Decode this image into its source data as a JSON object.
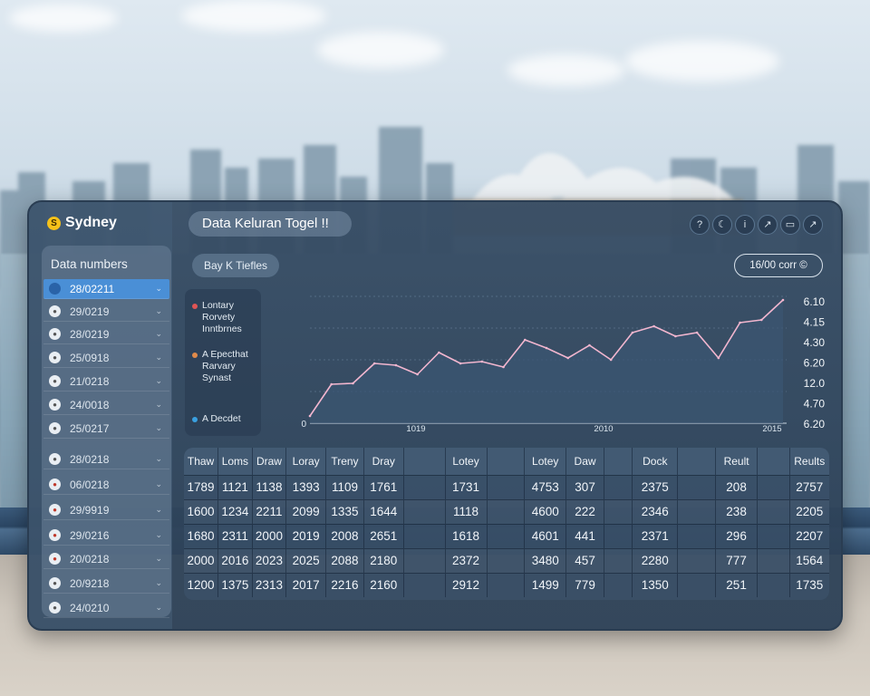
{
  "brand": {
    "name": "Sydney",
    "badge": "S"
  },
  "header": {
    "title": "Data Keluran Togel !!",
    "subtitle": "Bay K Tiefles"
  },
  "toolbar": [
    "?",
    "☾",
    "i",
    "↗",
    "▭",
    "↗"
  ],
  "counter": "16/00 corr ©",
  "sidebar": {
    "title": "Data numbers",
    "items": [
      {
        "label": "28/02211",
        "active": true
      },
      {
        "label": "29/0219",
        "active": false
      },
      {
        "label": "28/0219",
        "active": false
      },
      {
        "label": "25/0918",
        "active": false
      },
      {
        "label": "21/0218",
        "active": false
      },
      {
        "label": "24/0018",
        "active": false
      },
      {
        "label": "25/0217",
        "active": false
      },
      {
        "label": "28/0218",
        "active": false
      },
      {
        "label": "06/0218",
        "active": false
      },
      {
        "label": "29/9919",
        "active": false
      },
      {
        "label": "29/0216",
        "active": false
      },
      {
        "label": "20/0218",
        "active": false
      },
      {
        "label": "20/9218",
        "active": false
      },
      {
        "label": "24/0210",
        "active": false
      }
    ],
    "icon_colors": [
      "#2a63a8",
      "#555",
      "#555",
      "#555",
      "#555",
      "#555",
      "#555",
      "#555",
      "#c0392b",
      "#c0392b",
      "#c0392b",
      "#c0392b",
      "#555",
      "#555"
    ]
  },
  "legend": [
    {
      "label": "Lontary Rorvety Inntbrnes",
      "color": "#e05555"
    },
    {
      "label": "A Epecthat Rarvary Synast",
      "color": "#e08a4a"
    },
    {
      "label": "A Decdet",
      "color": "#3aa0e0"
    }
  ],
  "chart_data": {
    "type": "line",
    "x_ticks": [
      "1019",
      "2010",
      "2015"
    ],
    "y_ticks_left": [
      "",
      "",
      "",
      "",
      "0"
    ],
    "y_ticks_right": [
      "6.10",
      "4.15",
      "4.30",
      "6.20",
      "12.0",
      "4.70",
      "6.20"
    ],
    "series": [
      {
        "values": [
          0.4,
          2.15,
          2.2,
          3.3,
          3.2,
          2.7,
          3.9,
          3.3,
          3.4,
          3.1,
          4.6,
          4.15,
          3.6,
          4.3,
          3.5,
          5.0,
          5.35,
          4.8,
          5.0,
          3.6,
          5.55,
          5.7,
          6.8
        ]
      }
    ],
    "ylim": [
      0,
      7
    ],
    "line_color": "#f2b6cf",
    "fill_color": "#3b5672"
  },
  "table": {
    "headers": [
      "Thaw",
      "Loms",
      "Draw",
      "Loray",
      "Treny",
      "Dray",
      "",
      "Lotey",
      "",
      "Lotey",
      "Daw",
      "",
      "Dock",
      "",
      "Reult",
      "",
      "Reults"
    ],
    "rows": [
      [
        "1789",
        "1121",
        "1138",
        "1393",
        "1109",
        "1761",
        "",
        "1731",
        "",
        "4753",
        "307",
        "",
        "2375",
        "",
        "208",
        "",
        "2757"
      ],
      [
        "1600",
        "1234",
        "2211",
        "2099",
        "1335",
        "1644",
        "",
        "1118",
        "",
        "4600",
        "222",
        "",
        "2346",
        "",
        "238",
        "",
        "2205"
      ],
      [
        "1680",
        "2311",
        "2000",
        "2019",
        "2008",
        "2651",
        "",
        "1618",
        "",
        "4601",
        "441",
        "",
        "2371",
        "",
        "296",
        "",
        "2207"
      ],
      [
        "2000",
        "2016",
        "2023",
        "2025",
        "2088",
        "2180",
        "",
        "2372",
        "",
        "3480",
        "457",
        "",
        "2280",
        "",
        "777",
        "",
        "1564"
      ],
      [
        "1200",
        "1375",
        "2313",
        "2017",
        "2216",
        "2160",
        "",
        "2912",
        "",
        "1499",
        "779",
        "",
        "1350",
        "",
        "251",
        "",
        "1735"
      ]
    ]
  }
}
